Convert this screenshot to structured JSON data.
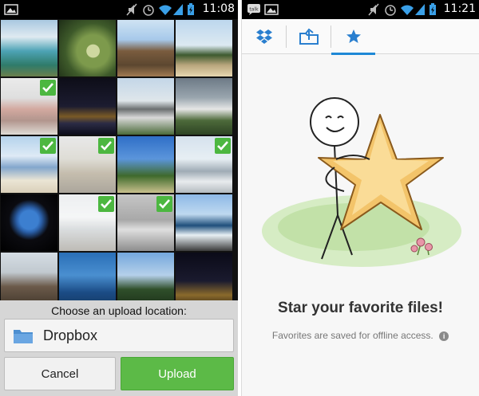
{
  "left_screen": {
    "status_bar": {
      "time": "11:08"
    },
    "photo_grid": {
      "rows": 5,
      "columns": 4,
      "tiles": [
        {
          "bg": "linear-gradient(180deg,#a9c8e0 0%,#dfeaf1 30%,#4da3b5 55%,#2f7b6a 80%,#6a7e4b 100%)",
          "selected": false
        },
        {
          "bg": "radial-gradient(circle at 60% 55%,#cfd8a0 0 14%,#7d9a4c 15% 35%,#3e5a2a 60%,#1e2e17 100%)",
          "selected": false
        },
        {
          "bg": "linear-gradient(180deg,#cfe3f3 0%,#a7c9ea 35%,#7a5c3e 55%,#5c4730 80%,#a07a52 100%)",
          "selected": false
        },
        {
          "bg": "linear-gradient(180deg,#bcd7ee 0%,#dce9f1 45%,#3d5a2f 62%,#b9a67d 80%,#e7d7b0 100%)",
          "selected": false
        },
        {
          "bg": "linear-gradient(180deg,#dcdcdc 0%,#c7c7c7 35%,#b36b5b 55%,#7a4a3c 75%,#c9c2b8 100%)",
          "selected": true
        },
        {
          "bg": "linear-gradient(180deg,#0d0d18 0%,#1c1c30 50%,#7a5a26 68%,#2b2b45 80%,#0e0e1c 100%)",
          "selected": false
        },
        {
          "bg": "linear-gradient(180deg,#c3d6e8 0%,#dfe6ea 40%,#6b6f70 55%,#d8d8d8 70%,#4b6b3a 100%)",
          "selected": false
        },
        {
          "bg": "linear-gradient(180deg,#6d7a86 0%,#9aa6af 35%,#e6e6e6 55%,#4d6a3b 75%,#2e4423 100%)",
          "selected": false
        },
        {
          "bg": "linear-gradient(180deg,#7fb2de 0%,#c6dcef 35%,#2a66a8 55%,#dcd3b6 78%,#bfae88 100%)",
          "selected": true
        },
        {
          "bg": "linear-gradient(180deg,#d9d9d9 0%,#c7c4b8 40%,#9c8f74 65%,#6f6655 100%)",
          "selected": true
        },
        {
          "bg": "linear-gradient(180deg,#2f6fc7 0%,#5b95db 40%,#3f6a2c 70%,#c9c18d 100%)",
          "selected": false
        },
        {
          "bg": "linear-gradient(180deg,#b7cde0 0%,#d6e3ec 40%,#5a6f7f 62%,#d8dde2 80%,#7d8a92 100%)",
          "selected": true
        },
        {
          "bg": "radial-gradient(circle at 50% 45%,#3c7fd0 0 22%,#2a5ea6 30%,#0b0b10 48%,#000 100%)",
          "selected": false
        },
        {
          "bg": "linear-gradient(180deg,#dfe3e6 0%,#eef0f1 40%,#bfc4c7 62%,#8e8a80 100%)",
          "selected": true
        },
        {
          "bg": "linear-gradient(180deg,#9c9c9c 0%,#6a6a6a 45%,#c8c8c8 62%,#3b3b3b 100%)",
          "selected": true
        },
        {
          "bg": "linear-gradient(180deg,#8db8e6 0%,#bfd9f0 35%,#1f4f7b 55%,#e8f0f4 72%,#3a3a3a 100%)",
          "selected": false
        },
        {
          "bg": "linear-gradient(180deg,#d5dde4 0%,#c1c9cf 35%,#6b5a4a 60%,#3e3429 100%)",
          "selected": false
        },
        {
          "bg": "linear-gradient(180deg,#2a6fb7 0%,#4a8fd0 40%,#1b4c86 70%,#143860 100%)",
          "selected": false
        },
        {
          "bg": "linear-gradient(180deg,#74a7dc 0%,#b5d0ea 40%,#2f4f2a 65%,#1b2d18 100%)",
          "selected": false
        },
        {
          "bg": "linear-gradient(180deg,#0b0b18 0%,#1a1a2e 50%,#8a6a2c 75%,#2a2010 100%)",
          "selected": false
        }
      ]
    },
    "upload_prompt": "Choose an upload location:",
    "location": "Dropbox",
    "cancel_label": "Cancel",
    "upload_label": "Upload"
  },
  "right_screen": {
    "status_bar": {
      "time": "11:21"
    },
    "tabs": [
      {
        "icon": "dropbox-icon",
        "active": false
      },
      {
        "icon": "upload-folder-icon",
        "active": false
      },
      {
        "icon": "star-icon",
        "active": true
      }
    ],
    "empty_title": "Star your favorite files!",
    "empty_subtitle": "Favorites are saved for offline access."
  },
  "colors": {
    "accent_blue": "#1e88d6",
    "upload_green": "#5cba47",
    "check_green": "#4cb740",
    "status_bar": "#000000"
  }
}
